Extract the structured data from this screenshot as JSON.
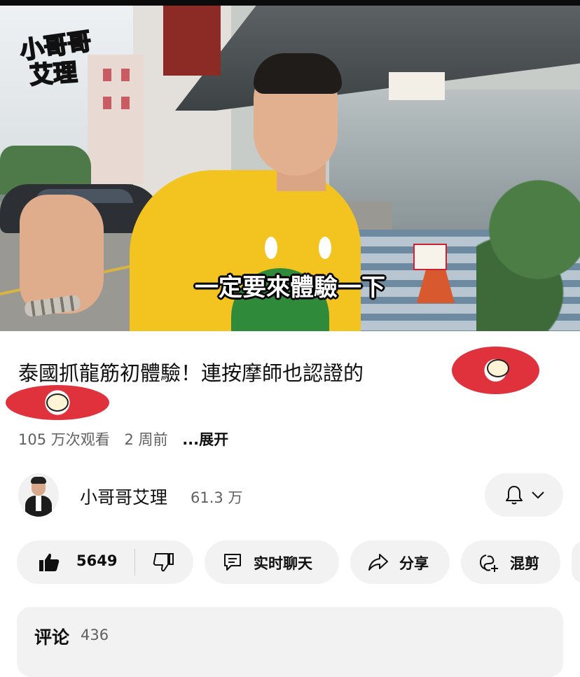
{
  "video": {
    "logo_line1": "小哥哥",
    "logo_line2": "艾理",
    "subtitle": "一定要來體驗一下",
    "progress_fraction": 0.06
  },
  "title": {
    "text": "泰國抓龍筋初體驗！連按摩師也認證的"
  },
  "meta": {
    "views": "105 万次观看",
    "age": "2 周前",
    "expand": "...展开"
  },
  "channel": {
    "name": "小哥哥艾理",
    "subscribers": "61.3 万"
  },
  "actions": {
    "like_count": "5649",
    "live_chat": "实时聊天",
    "share": "分享",
    "remix": "混剪"
  },
  "comments": {
    "title": "评论",
    "count": "436"
  },
  "icons": {
    "like": "thumbs-up-icon",
    "dislike": "thumbs-down-icon",
    "chat": "chat-bubble-icon",
    "share": "share-arrow-icon",
    "remix": "remix-icon",
    "bell": "bell-icon",
    "chevron": "chevron-down-icon"
  },
  "colors": {
    "progress": "#ff0000",
    "chip_bg": "#f2f2f2",
    "secondary_text": "#606060"
  }
}
